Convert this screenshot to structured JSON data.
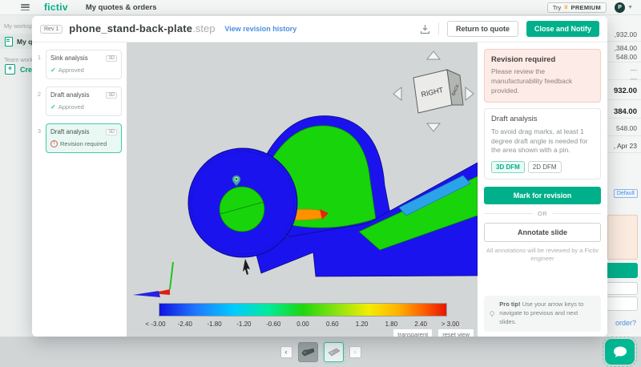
{
  "colors": {
    "accent": "#00b08b",
    "link": "#4a90e2",
    "error": "#e0574e",
    "alert_bg": "#fcebe6"
  },
  "topbar": {
    "brand": "fictiv",
    "title": "My quotes & orders",
    "try_label": "Try",
    "premium_label": "PREMIUM",
    "avatar_initial": "P"
  },
  "workspace": {
    "section_personal": "My workspace",
    "item_quotes": "My quotes & orders",
    "section_team": "Team workspace",
    "create_label": "Create"
  },
  "modal": {
    "rev_badge": "Rev 1",
    "filename": "phone_stand-back-plate",
    "file_ext": ".step",
    "revision_link": "View revision history",
    "return_button": "Return to quote",
    "close_button": "Close and Notify"
  },
  "slides": [
    {
      "num": "1",
      "title": "Sink analysis",
      "badge": "3D",
      "status": "Approved"
    },
    {
      "num": "2",
      "title": "Draft analysis",
      "badge": "3D",
      "status": "Approved"
    },
    {
      "num": "3",
      "title": "Draft analysis",
      "badge": "3D",
      "status": "Revision required"
    }
  ],
  "viewer": {
    "cube_front": "RIGHT",
    "cube_side": "BACK",
    "scale_labels": [
      "< -3.00",
      "-2.40",
      "-1.80",
      "-1.20",
      "-0.60",
      "0.00",
      "0.60",
      "1.20",
      "1.80",
      "2.40",
      "> 3.00"
    ],
    "transparent_button": "transparent",
    "reset_button": "reset view"
  },
  "panel": {
    "alert_title": "Revision required",
    "alert_body": "Please review the manufacturability feedback provided.",
    "analysis_title": "Draft analysis",
    "analysis_body": "To avoid drag marks, at least 1 degree draft angle is needed for the area shown with a pin.",
    "dfm_3d": "3D DFM",
    "dfm_2d": "2D DFM",
    "mark_button": "Mark for revision",
    "or_label": "OR",
    "annotate_button": "Annotate slide",
    "annotation_note": "All annotations will be reviewed by a Fictiv engineer",
    "protip_label": "Pro tip!",
    "protip_text": "Use your arrow keys to navigate to previous and next slides."
  },
  "background": {
    "right_rows": [
      ",932.00",
      ",384.00",
      "548.00",
      "—",
      "—",
      "932.00",
      "384.00",
      "548.00",
      ", Apr 23"
    ],
    "default_badge": "Default",
    "order_link": "order?"
  },
  "bottom_nav": {
    "prev": "‹",
    "next": "›"
  }
}
